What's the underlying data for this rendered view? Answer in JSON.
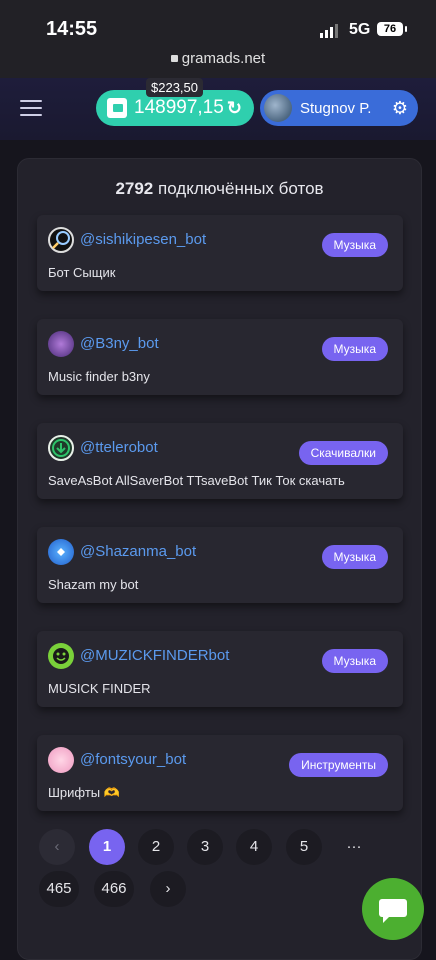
{
  "status": {
    "time": "14:55",
    "network": "5G",
    "battery": "76",
    "url": "gramads.net"
  },
  "header": {
    "balance_usd": "$223,50",
    "balance": "148997,15",
    "username": "Stugnov P.",
    "icons": [
      "menu-icon",
      "wallet-icon",
      "refresh-icon",
      "gear-icon"
    ]
  },
  "panel": {
    "count": "2792",
    "title_suffix": "подключённых ботов"
  },
  "bots": [
    {
      "username": "@sishikipesen_bot",
      "description": "Бот Сыщик",
      "category": "Музыка"
    },
    {
      "username": "@B3ny_bot",
      "description": "Music finder b3ny",
      "category": "Музыка"
    },
    {
      "username": "@ttelerobot",
      "description": "SaveAsBot AllSaverBot TTsaveBot Тик Ток скачать",
      "category": "Скачивалки"
    },
    {
      "username": "@Shazanma_bot",
      "description": "Shazam my bot",
      "category": "Музыка"
    },
    {
      "username": "@MUZICKFINDERbot",
      "description": "MUSICK FINDER",
      "category": "Музыка"
    },
    {
      "username": "@fontsyour_bot",
      "description": "Шрифты 🫶",
      "category": "Инструменты"
    }
  ],
  "pagination": {
    "pages": [
      "1",
      "2",
      "3",
      "4",
      "5"
    ],
    "ellipsis": "···",
    "last_pages": [
      "465",
      "466"
    ],
    "current": "1"
  },
  "colors": {
    "accent": "#7864f0",
    "balance": "#2fcfae",
    "user": "#3a6cd9",
    "fab": "#4caf30",
    "link": "#5b9aee"
  }
}
